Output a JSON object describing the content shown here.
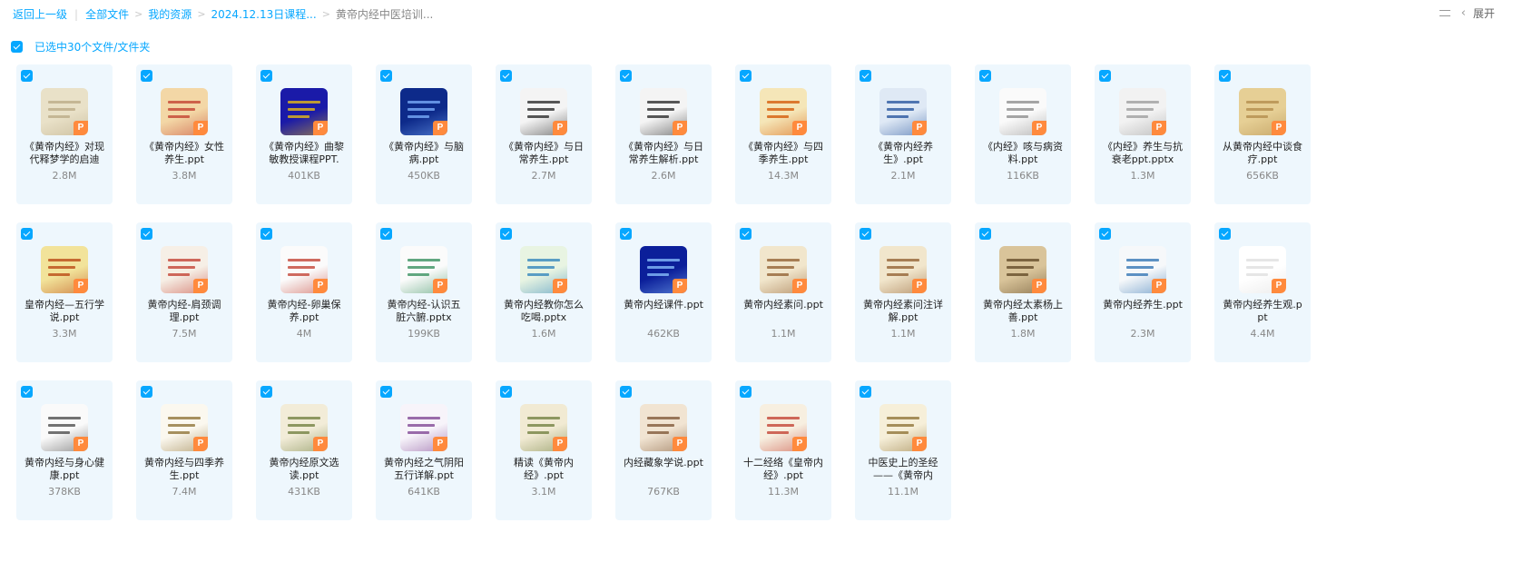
{
  "breadcrumb": {
    "back": "返回上一级",
    "items": [
      "全部文件",
      "我的资源",
      "2024.12.13日课程...",
      "黄帝内经中医培训..."
    ]
  },
  "toolbar": {
    "expand_label": "展开"
  },
  "selection": {
    "label": "已选中30个文件/文件夹"
  },
  "colors": {
    "accent": "#06a7ff",
    "card_bg": "#eef7fd",
    "ppt_badge": "#ff8a3d"
  },
  "files": [
    {
      "name": "《黄帝内经》对现代释梦学的启迪",
      "size": "2.8M",
      "thumb": [
        "#e9e1c8",
        "#b8a884"
      ]
    },
    {
      "name": "《黄帝内经》女性养生.ppt",
      "size": "3.8M",
      "thumb": [
        "#f3d7a6",
        "#c0392b"
      ]
    },
    {
      "name": "《黄帝内经》曲黎敏教授课程PPT.",
      "size": "401KB",
      "thumb": [
        "#1a1aa8",
        "#f1c40f"
      ]
    },
    {
      "name": "《黄帝内经》与脑病.ppt",
      "size": "450KB",
      "thumb": [
        "#0d2a8a",
        "#7fb3ff"
      ]
    },
    {
      "name": "《黄帝内经》与日常养生.ppt",
      "size": "2.7M",
      "thumb": [
        "#f4f4f4",
        "#222222"
      ]
    },
    {
      "name": "《黄帝内经》与日常养生解析.ppt",
      "size": "2.6M",
      "thumb": [
        "#f4f4f4",
        "#222222"
      ]
    },
    {
      "name": "《黄帝内经》与四季养生.ppt",
      "size": "14.3M",
      "thumb": [
        "#f5e6b8",
        "#d35400"
      ]
    },
    {
      "name": "《黄帝内经养生》.ppt",
      "size": "2.1M",
      "thumb": [
        "#dfe9f5",
        "#1f4e99"
      ]
    },
    {
      "name": "《内经》咳与病资料.ppt",
      "size": "116KB",
      "thumb": [
        "#fafafa",
        "#888888"
      ]
    },
    {
      "name": "《内经》养生与抗衰老ppt.pptx",
      "size": "1.3M",
      "thumb": [
        "#f2f2f2",
        "#999999"
      ]
    },
    {
      "name": "从黄帝内经中谈食疗.ppt",
      "size": "656KB",
      "thumb": [
        "#e6cf95",
        "#b08a4a"
      ]
    },
    {
      "name": "皇帝内经—五行学说.ppt",
      "size": "3.3M",
      "thumb": [
        "#f2e39a",
        "#b7410e"
      ]
    },
    {
      "name": "黄帝内经-肩颈调理.ppt",
      "size": "7.5M",
      "thumb": [
        "#f6efe6",
        "#c0392b"
      ]
    },
    {
      "name": "黄帝内经-卵巢保养.ppt",
      "size": "4M",
      "thumb": [
        "#fbfbfb",
        "#c0392b"
      ]
    },
    {
      "name": "黄帝内经-认识五脏六腑.pptx",
      "size": "199KB",
      "thumb": [
        "#fbfbfb",
        "#2e8b57"
      ]
    },
    {
      "name": "黄帝内经教你怎么吃喝.pptx",
      "size": "1.6M",
      "thumb": [
        "#e8f4e2",
        "#2980b9"
      ]
    },
    {
      "name": "黄帝内经课件.ppt",
      "size": "462KB",
      "thumb": [
        "#0b1f9a",
        "#8ec5ff"
      ]
    },
    {
      "name": "黄帝内经素问.ppt",
      "size": "1.1M",
      "thumb": [
        "#f1e6cc",
        "#8e5b2c"
      ]
    },
    {
      "name": "黄帝内经素问注详解.ppt",
      "size": "1.1M",
      "thumb": [
        "#f1e6cc",
        "#8e5b2c"
      ]
    },
    {
      "name": "黄帝内经太素杨上善.ppt",
      "size": "1.8M",
      "thumb": [
        "#d9c49a",
        "#5c4422"
      ]
    },
    {
      "name": "黄帝内经养生.ppt",
      "size": "2.3M",
      "thumb": [
        "#f6f8fa",
        "#2a6fb0"
      ]
    },
    {
      "name": "黄帝内经养生观.ppt",
      "size": "4.4M",
      "thumb": [
        "#ffffff",
        "#dddddd"
      ]
    },
    {
      "name": "黄帝内经与身心健康.ppt",
      "size": "378KB",
      "thumb": [
        "#fafafa",
        "#444444"
      ]
    },
    {
      "name": "黄帝内经与四季养生.ppt",
      "size": "7.4M",
      "thumb": [
        "#fbf8ef",
        "#8a6d2f"
      ]
    },
    {
      "name": "黄帝内经原文选读.ppt",
      "size": "431KB",
      "thumb": [
        "#f2ecd8",
        "#6b7b3a"
      ]
    },
    {
      "name": "黄帝内经之气阴阳五行详解.ppt",
      "size": "641KB",
      "thumb": [
        "#f7f4fa",
        "#7a3d8f"
      ]
    },
    {
      "name": "精读《黄帝内经》.ppt",
      "size": "3.1M",
      "thumb": [
        "#f1ead3",
        "#6b7b3a"
      ]
    },
    {
      "name": "内经藏象学说.ppt",
      "size": "767KB",
      "thumb": [
        "#f1e4d2",
        "#7a5230"
      ]
    },
    {
      "name": "十二经络《皇帝内经》.ppt",
      "size": "11.3M",
      "thumb": [
        "#f7efe0",
        "#c0392b"
      ]
    },
    {
      "name": "中医史上的圣经——《黄帝内经》.",
      "size": "11.1M",
      "thumb": [
        "#f6efd9",
        "#8a6d2f"
      ]
    }
  ]
}
